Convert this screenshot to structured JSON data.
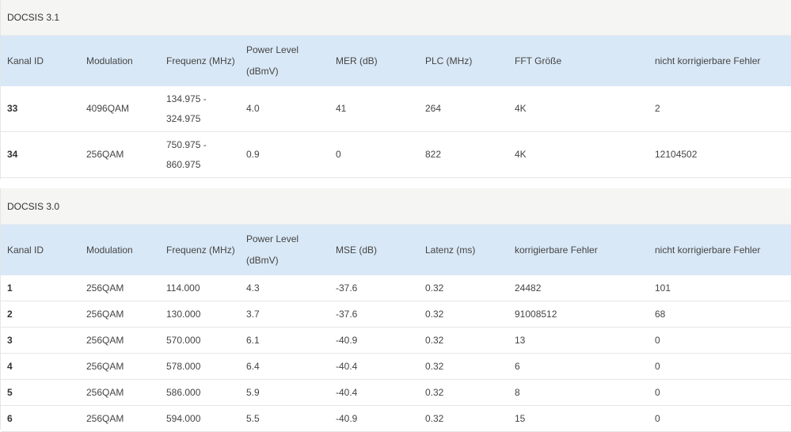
{
  "docsis31": {
    "title": "DOCSIS 3.1",
    "headers": [
      "Kanal ID",
      "Modulation",
      "Frequenz (MHz)",
      "Power Level",
      "(dBmV)",
      "MER (dB)",
      "PLC (MHz)",
      "FFT Größe",
      "nicht korrigierbare Fehler"
    ],
    "rows": [
      {
        "id": "33",
        "modulation": "4096QAM",
        "freq1": "134.975 -",
        "freq2": "324.975",
        "power": "4.0",
        "mer": "41",
        "plc": "264",
        "fft": "4K",
        "uncorrectable": "2"
      },
      {
        "id": "34",
        "modulation": "256QAM",
        "freq1": "750.975 -",
        "freq2": "860.975",
        "power": "0.9",
        "mer": "0",
        "plc": "822",
        "fft": "4K",
        "uncorrectable": "12104502"
      }
    ]
  },
  "docsis30": {
    "title": "DOCSIS 3.0",
    "headers": [
      "Kanal ID",
      "Modulation",
      "Frequenz (MHz)",
      "Power Level",
      "(dBmV)",
      "MSE (dB)",
      "Latenz (ms)",
      "korrigierbare Fehler",
      "nicht korrigierbare Fehler"
    ],
    "rows": [
      {
        "id": "1",
        "modulation": "256QAM",
        "freq": "114.000",
        "power": "4.3",
        "mse": "-37.6",
        "latency": "0.32",
        "correctable": "24482",
        "uncorrectable": "101"
      },
      {
        "id": "2",
        "modulation": "256QAM",
        "freq": "130.000",
        "power": "3.7",
        "mse": "-37.6",
        "latency": "0.32",
        "correctable": "91008512",
        "uncorrectable": "68"
      },
      {
        "id": "3",
        "modulation": "256QAM",
        "freq": "570.000",
        "power": "6.1",
        "mse": "-40.9",
        "latency": "0.32",
        "correctable": "13",
        "uncorrectable": "0"
      },
      {
        "id": "4",
        "modulation": "256QAM",
        "freq": "578.000",
        "power": "6.4",
        "mse": "-40.4",
        "latency": "0.32",
        "correctable": "6",
        "uncorrectable": "0"
      },
      {
        "id": "5",
        "modulation": "256QAM",
        "freq": "586.000",
        "power": "5.9",
        "mse": "-40.4",
        "latency": "0.32",
        "correctable": "8",
        "uncorrectable": "0"
      },
      {
        "id": "6",
        "modulation": "256QAM",
        "freq": "594.000",
        "power": "5.5",
        "mse": "-40.9",
        "latency": "0.32",
        "correctable": "15",
        "uncorrectable": "0"
      }
    ]
  }
}
